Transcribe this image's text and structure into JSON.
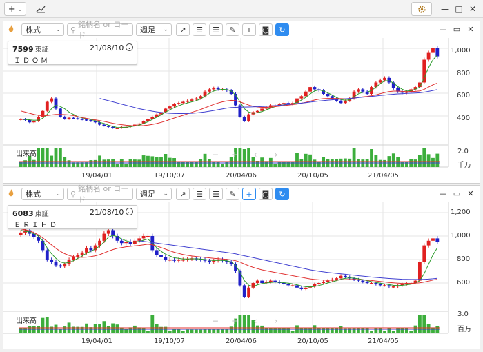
{
  "topbar": {
    "add_label": "+",
    "add_caret": "⌄",
    "chart_icon": "trend-icon",
    "settings_icon": "gear-icon",
    "win": {
      "min": "—",
      "max": "□",
      "close": "✕"
    }
  },
  "panels": [
    {
      "toolbar": {
        "type_select": "株式",
        "search_placeholder": "銘柄名 or コード",
        "period_select": "週足"
      },
      "info": {
        "code": "7599",
        "exchange": "東証",
        "date": "21/08/10",
        "name": "ＩＤＯＭ"
      },
      "y_ticks": [
        "1,000",
        "800",
        "600",
        "400"
      ],
      "x_ticks": [
        "19/04/01",
        "19/10/07",
        "20/04/06",
        "20/10/05",
        "21/04/05"
      ],
      "volume": {
        "title": "出来高",
        "max": "2.0",
        "unit": "千万"
      },
      "nav": {
        "minus": "−",
        "plus": "+",
        "prev": "‹",
        "next": "›"
      }
    },
    {
      "toolbar": {
        "type_select": "株式",
        "search_placeholder": "銘柄名 or コード",
        "period_select": "週足"
      },
      "info": {
        "code": "6083",
        "exchange": "東証",
        "date": "21/08/10",
        "name": "ＥＲＩＨＤ"
      },
      "y_ticks": [
        "1,200",
        "1,000",
        "800",
        "600"
      ],
      "x_ticks": [
        "19/04/01",
        "19/10/07",
        "20/04/06",
        "20/10/05",
        "21/04/05"
      ],
      "volume": {
        "title": "出来高",
        "max": "3.0",
        "unit": "百万"
      },
      "nav": {
        "minus": "−",
        "plus": "+",
        "prev": "‹",
        "next": "›"
      }
    }
  ],
  "chart_data": [
    {
      "type": "candlestick",
      "symbol": "7599",
      "ylim": [
        250,
        1050
      ],
      "closes": [
        380,
        370,
        350,
        360,
        400,
        450,
        530,
        560,
        470,
        400,
        380,
        390,
        385,
        380,
        375,
        370,
        360,
        350,
        330,
        320,
        310,
        300,
        300,
        310,
        310,
        320,
        330,
        340,
        360,
        380,
        400,
        420,
        440,
        470,
        490,
        510,
        520,
        530,
        540,
        550,
        560,
        580,
        620,
        640,
        650,
        640,
        640,
        630,
        600,
        500,
        400,
        360,
        420,
        440,
        450,
        470,
        480,
        500,
        500,
        510,
        520,
        510,
        520,
        560,
        580,
        620,
        660,
        640,
        630,
        600,
        580,
        560,
        540,
        520,
        540,
        560,
        620,
        640,
        620,
        600,
        660,
        700,
        720,
        740,
        700,
        650,
        620,
        610,
        620,
        640,
        660,
        700,
        900,
        960,
        1000,
        930
      ],
      "ma_short": [
        380,
        375,
        372,
        368,
        370,
        385,
        420,
        470,
        500,
        490,
        470,
        440,
        420,
        400,
        390,
        380,
        375,
        365,
        350,
        340,
        325,
        315,
        305,
        305,
        308,
        312,
        318,
        325,
        340,
        355,
        375,
        395,
        415,
        440,
        460,
        480,
        495,
        510,
        520,
        530,
        540,
        555,
        580,
        605,
        625,
        635,
        640,
        638,
        625,
        590,
        530,
        470,
        440,
        430,
        435,
        445,
        460,
        475,
        488,
        498,
        505,
        510,
        512,
        525,
        545,
        570,
        600,
        625,
        635,
        625,
        610,
        590,
        570,
        550,
        545,
        548,
        575,
        600,
        615,
        615,
        630,
        660,
        690,
        715,
        715,
        695,
        665,
        640,
        625,
        628,
        640,
        660,
        740,
        830,
        900,
        940
      ],
      "ma_mid": [
        450,
        440,
        430,
        420,
        412,
        408,
        410,
        415,
        420,
        420,
        418,
        415,
        410,
        400,
        392,
        385,
        378,
        372,
        365,
        358,
        350,
        342,
        335,
        330,
        325,
        322,
        320,
        320,
        322,
        326,
        332,
        340,
        350,
        362,
        375,
        388,
        400,
        412,
        425,
        438,
        450,
        463,
        478,
        493,
        508,
        520,
        530,
        538,
        543,
        540,
        530,
        515,
        502,
        492,
        485,
        482,
        482,
        484,
        488,
        492,
        497,
        502,
        506,
        511,
        518,
        526,
        536,
        546,
        553,
        558,
        560,
        560,
        559,
        558,
        557,
        558,
        562,
        568,
        574,
        578,
        584,
        592,
        602,
        612,
        620,
        624,
        624,
        622,
        620,
        620,
        622,
        626,
        640,
        660,
        680,
        695
      ],
      "ma_long": [
        null,
        null,
        null,
        null,
        null,
        null,
        null,
        null,
        null,
        null,
        null,
        null,
        null,
        null,
        null,
        null,
        null,
        null,
        560,
        550,
        540,
        530,
        520,
        510,
        500,
        490,
        480,
        470,
        462,
        455,
        448,
        442,
        437,
        433,
        430,
        428,
        427,
        427,
        428,
        430,
        433,
        437,
        442,
        448,
        454,
        461,
        468,
        475,
        480,
        482,
        483,
        484,
        485,
        486,
        487,
        489,
        491,
        494,
        497,
        500,
        503,
        507,
        511,
        515,
        519,
        523,
        528,
        533,
        537,
        541,
        545,
        548,
        551,
        554,
        557,
        560,
        563,
        567,
        571,
        574,
        578,
        582,
        586,
        590,
        594,
        597,
        600,
        602,
        604,
        606,
        608,
        610,
        615,
        622,
        630,
        638
      ],
      "volume_max": 2.0,
      "volume_unit": "千万"
    },
    {
      "type": "candlestick",
      "symbol": "6083",
      "ylim": [
        400,
        1250
      ],
      "closes": [
        1030,
        1050,
        1020,
        990,
        960,
        880,
        800,
        780,
        750,
        740,
        760,
        800,
        820,
        840,
        860,
        900,
        880,
        920,
        960,
        1020,
        1050,
        1000,
        960,
        940,
        950,
        930,
        960,
        980,
        1000,
        1000,
        880,
        840,
        820,
        800,
        800,
        790,
        800,
        800,
        805,
        810,
        805,
        800,
        790,
        780,
        790,
        800,
        790,
        780,
        760,
        700,
        580,
        480,
        560,
        600,
        620,
        600,
        610,
        620,
        610,
        600,
        590,
        580,
        580,
        560,
        550,
        560,
        570,
        590,
        600,
        610,
        620,
        630,
        640,
        660,
        650,
        640,
        630,
        620,
        610,
        600,
        600,
        590,
        580,
        580,
        570,
        570,
        580,
        590,
        600,
        600,
        620,
        780,
        920,
        960,
        980,
        950
      ],
      "ma_short": [
        1050,
        1040,
        1035,
        1020,
        1000,
        960,
        900,
        850,
        810,
        780,
        770,
        775,
        790,
        810,
        830,
        855,
        870,
        890,
        915,
        950,
        990,
        1005,
        995,
        975,
        960,
        950,
        948,
        955,
        965,
        975,
        940,
        900,
        870,
        845,
        830,
        815,
        810,
        805,
        804,
        806,
        806,
        804,
        800,
        795,
        792,
        793,
        793,
        790,
        780,
        750,
        690,
        620,
        580,
        570,
        585,
        595,
        600,
        605,
        608,
        606,
        603,
        598,
        593,
        585,
        575,
        568,
        566,
        570,
        578,
        588,
        600,
        610,
        620,
        632,
        640,
        643,
        641,
        636,
        628,
        620,
        612,
        605,
        598,
        592,
        586,
        580,
        578,
        580,
        584,
        590,
        598,
        620,
        680,
        760,
        840,
        900
      ],
      "ma_mid": [
        1060,
        1055,
        1045,
        1030,
        1010,
        985,
        955,
        925,
        895,
        870,
        850,
        835,
        825,
        820,
        818,
        820,
        825,
        832,
        842,
        856,
        872,
        885,
        895,
        902,
        908,
        912,
        916,
        920,
        925,
        930,
        925,
        915,
        902,
        888,
        874,
        862,
        852,
        843,
        836,
        830,
        826,
        822,
        818,
        814,
        810,
        807,
        804,
        801,
        797,
        790,
        778,
        762,
        746,
        733,
        722,
        712,
        704,
        697,
        690,
        683,
        676,
        669,
        662,
        655,
        648,
        641,
        635,
        630,
        627,
        625,
        624,
        624,
        625,
        627,
        629,
        630,
        630,
        629,
        627,
        624,
        621,
        617,
        613,
        609,
        605,
        601,
        598,
        596,
        596,
        597,
        599,
        602,
        608,
        616,
        625,
        632
      ],
      "ma_long": [
        null,
        null,
        null,
        null,
        null,
        null,
        null,
        null,
        null,
        null,
        null,
        null,
        null,
        null,
        null,
        null,
        null,
        null,
        null,
        null,
        null,
        null,
        null,
        null,
        null,
        null,
        null,
        960,
        955,
        950,
        945,
        940,
        935,
        930,
        925,
        920,
        915,
        910,
        905,
        900,
        895,
        890,
        885,
        880,
        875,
        870,
        865,
        860,
        855,
        848,
        840,
        832,
        824,
        816,
        808,
        800,
        792,
        784,
        776,
        768,
        760,
        752,
        744,
        736,
        728,
        720,
        712,
        706,
        700,
        695,
        690,
        686,
        682,
        678,
        674,
        670,
        666,
        662,
        658,
        654,
        650,
        647,
        644,
        641,
        638,
        636,
        634,
        632,
        631,
        630,
        630,
        630,
        631,
        633,
        636,
        640
      ],
      "volume_max": 3.0,
      "volume_unit": "百万"
    }
  ]
}
